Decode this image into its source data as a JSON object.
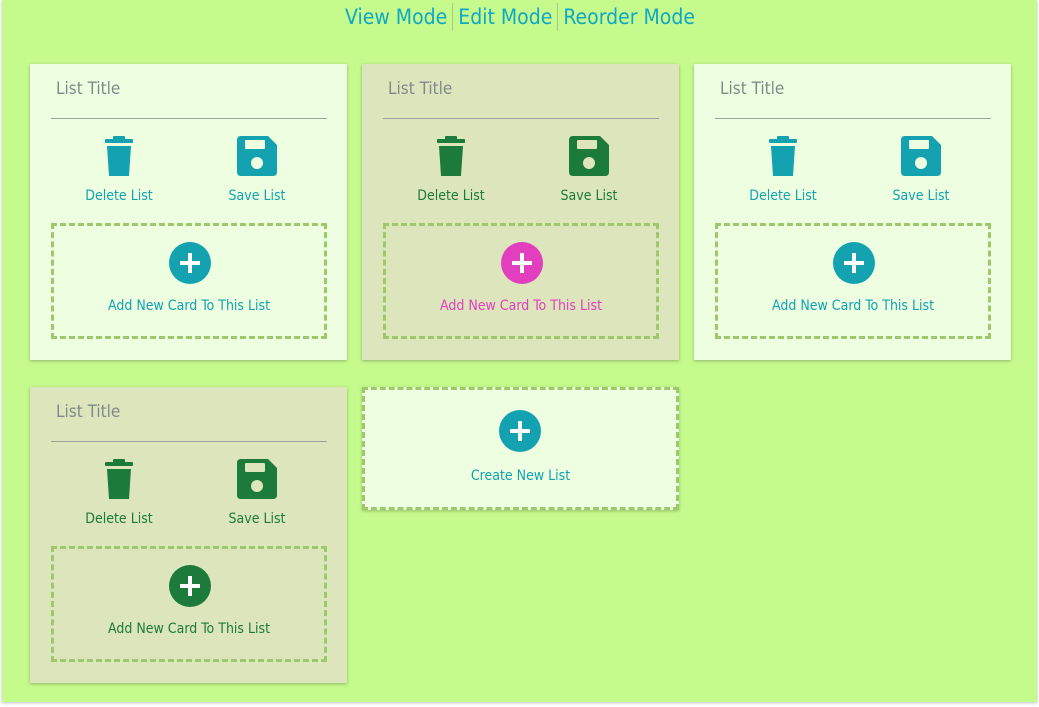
{
  "modes": {
    "view": "View Mode",
    "edit": "Edit Mode",
    "reorder": "Reorder Mode"
  },
  "colors": {
    "background": "#c5fa8d",
    "teal": "#14a2b0",
    "green": "#1c7b3a",
    "pink": "#e13fbd",
    "mode_link": "#10a8c4"
  },
  "lists": [
    {
      "title": "List Title",
      "delete_label": "Delete List",
      "save_label": "Save List",
      "add_card_label": "Add New Card To This List",
      "icon_color": "teal",
      "add_color": "teal"
    },
    {
      "title": "List Title",
      "delete_label": "Delete List",
      "save_label": "Save List",
      "add_card_label": "Add New Card To This List",
      "icon_color": "green",
      "add_color": "pink"
    },
    {
      "title": "List Title",
      "delete_label": "Delete List",
      "save_label": "Save List",
      "add_card_label": "Add New Card To This List",
      "icon_color": "teal",
      "add_color": "teal"
    },
    {
      "title": "List Title",
      "delete_label": "Delete List",
      "save_label": "Save List",
      "add_card_label": "Add New Card To This List",
      "icon_color": "green",
      "add_color": "green"
    }
  ],
  "create_list": {
    "label": "Create New List"
  }
}
